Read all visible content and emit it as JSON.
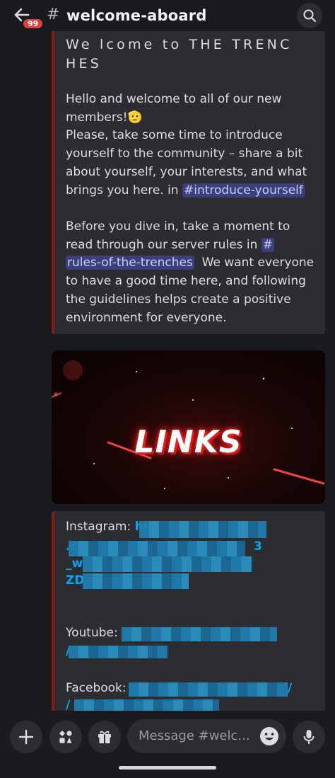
{
  "header": {
    "unread_badge": "99",
    "hash": "#",
    "channel_name": "welcome-aboard",
    "chevron": "›"
  },
  "embed_welcome": {
    "title_line1": "We lcome to THE TRENC",
    "title_line2": "HES",
    "p1_line1": "Hello and welcome to all of our new",
    "p1_line2": "members!",
    "p1_emoji": "🫡",
    "p2_line1": "Please, take some time to introduce",
    "p2_line2": "yourself to the community – share a bit",
    "p2_line3": "about yourself, your interests, and what",
    "p2_line4": "brings you here. in",
    "mention_intro": "#introduce-yourself",
    "p3_line1": "Before you dive in, take a moment to",
    "p3_line2": "read through our server rules in",
    "mention_rules_hash": "#",
    "mention_rules": "rules-of-the-trenches",
    "p3_after": "We want everyone",
    "p3_line4": "to have a good time here, and following",
    "p3_line5": "the guidelines helps create a positive",
    "p3_line6": "environment for everyone."
  },
  "banner": {
    "text": "LINKS"
  },
  "embed_links": {
    "instagram_label": "Instagram:",
    "instagram_link_start": "ht",
    "instagram_line2_start": ".c",
    "instagram_line2_end": "3",
    "instagram_line3_start": "_w",
    "instagram_line4_start": "ZD",
    "youtube_label": "Youtube:",
    "youtube_line2_start": "/",
    "facebook_label": "Facebook:",
    "facebook_link_end": "/",
    "facebook_line2_start": "/"
  },
  "composer": {
    "placeholder": "Message #welc..."
  },
  "colors": {
    "accent_mention": "#3c3f7a",
    "link": "#00a8fc",
    "embed_bar": "#8b1a1a",
    "badge": "#e23d3d"
  }
}
